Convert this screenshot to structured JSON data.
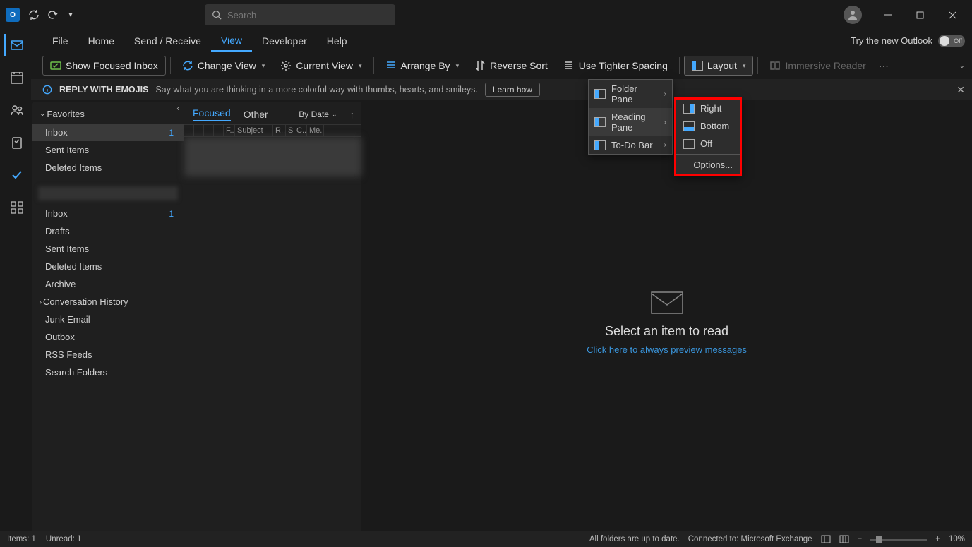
{
  "titlebar": {
    "search_placeholder": "Search"
  },
  "tabs": {
    "file": "File",
    "home": "Home",
    "sendreceive": "Send / Receive",
    "view": "View",
    "developer": "Developer",
    "help": "Help"
  },
  "trynew": {
    "label": "Try the new Outlook",
    "state": "Off"
  },
  "ribbon": {
    "focused": "Show Focused Inbox",
    "changeview": "Change View",
    "currentview": "Current View",
    "arrangeby": "Arrange By",
    "reverse": "Reverse Sort",
    "tighter": "Use Tighter Spacing",
    "layout": "Layout",
    "immersive": "Immersive Reader"
  },
  "layout_menu": {
    "folder": "Folder Pane",
    "reading": "Reading Pane",
    "todo": "To-Do Bar"
  },
  "reading_menu": {
    "right": "Right",
    "bottom": "Bottom",
    "off": "Off",
    "options": "Options..."
  },
  "infobar": {
    "title": "REPLY WITH EMOJIS",
    "text": "Say what you are thinking in a more colorful way with thumbs, hearts, and smileys.",
    "learn": "Learn how"
  },
  "favorites": {
    "header": "Favorites",
    "items": [
      {
        "label": "Inbox",
        "count": "1"
      },
      {
        "label": "Sent Items"
      },
      {
        "label": "Deleted Items"
      }
    ]
  },
  "account_folders": [
    {
      "label": "Inbox",
      "count": "1"
    },
    {
      "label": "Drafts"
    },
    {
      "label": "Sent Items"
    },
    {
      "label": "Deleted Items"
    },
    {
      "label": "Archive"
    },
    {
      "label": "Conversation History",
      "expandable": true
    },
    {
      "label": "Junk Email"
    },
    {
      "label": "Outbox"
    },
    {
      "label": "RSS Feeds"
    },
    {
      "label": "Search Folders"
    }
  ],
  "msglist": {
    "focused": "Focused",
    "other": "Other",
    "sortby": "By Date",
    "cols": [
      "",
      "",
      "",
      "",
      "F..",
      "Subject",
      "R..",
      "S",
      "C..",
      "Me..",
      ""
    ]
  },
  "reading": {
    "title": "Select an item to read",
    "link": "Click here to always preview messages"
  },
  "status": {
    "items": "Items: 1",
    "unread": "Unread: 1",
    "sync": "All folders are up to date.",
    "conn": "Connected to: Microsoft Exchange",
    "zoom": "10%"
  }
}
